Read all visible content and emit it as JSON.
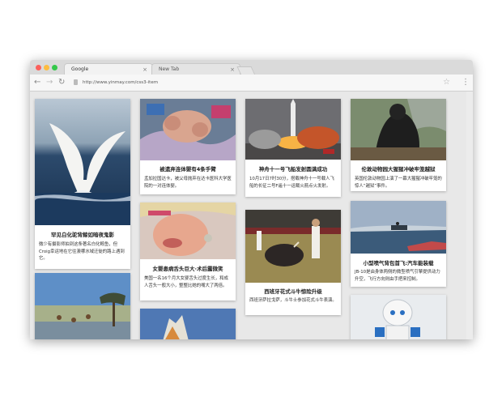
{
  "browser": {
    "tabs": [
      {
        "label": "Google",
        "close": "×"
      },
      {
        "label": "New Tab",
        "close": "×"
      }
    ],
    "nav": {
      "back": "←",
      "forward": "→",
      "reload": "↻",
      "star": "☆",
      "menu": "⋮"
    },
    "url": "http://www.yinmay.com/css3-item"
  },
  "cards": [
    {
      "title": "罕见白化驼背鲸如暗夜鬼影",
      "desc": "微少有摄影师拍到这条著名白化鲸鱼，但Croig幸运地在它往澳哪水域迁徙的路上遇到它。"
    },
    {
      "title": "被遗弃连体婴有4条手臂",
      "desc": "孟加拉国达卡，被父母抛弃在达卡医科大学医院的一对连体婴。"
    },
    {
      "title": "神舟十一号飞船发射圆满成功",
      "desc": "10月17日7时30分，搭载神舟十一号载人飞船的长征二号F遥十一运载火箭点火发射。"
    },
    {
      "title": "伦敦动物园大猩猩冲破牢笼越狱",
      "desc": "英国伦敦动物园上演了一幕大猩猩冲破牢笼的惊人“越狱”事件。"
    },
    {
      "title": "女婴患病舌头巨大·术后露微笑",
      "desc": "美国一名16个月大女婴舌头过度生长，和成人舌头一般大小，整整比她的嘴大了两倍。"
    },
    {
      "title": "西班牙花式斗牛惊险升级",
      "desc": "西班牙萨拉戈萨，斗牛士参加花式斗牛表演。"
    },
    {
      "title": "小型喷气背包首飞:汽车能装载",
      "desc": "JB-10是由身体两侧的微型喷气引擎提供动力升空，飞行方向则由手把来控制。"
    }
  ]
}
